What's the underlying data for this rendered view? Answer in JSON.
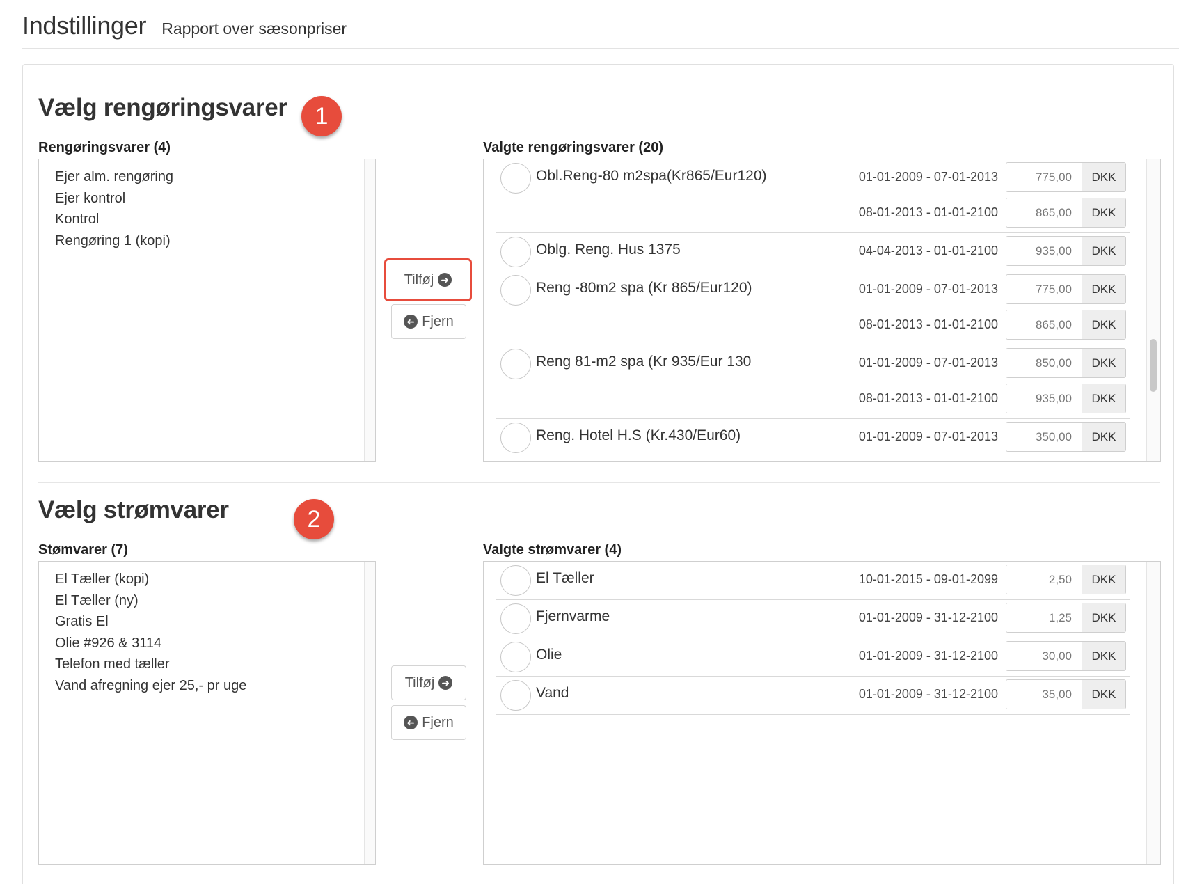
{
  "header": {
    "title": "Indstillinger",
    "subtitle": "Rapport over sæsonpriser"
  },
  "cleaning": {
    "heading": "Vælg rengøringsvarer",
    "badge": "1",
    "available_label": "Rengøringsvarer (4)",
    "available": [
      "Ejer alm. rengøring",
      "Ejer kontrol",
      "Kontrol",
      "Rengøring 1 (kopi)"
    ],
    "add_label": "Tilføj",
    "remove_label": "Fjern",
    "selected_label": "Valgte rengøringsvarer (20)",
    "selected": [
      {
        "name": "Obl.Reng-80 m2spa(Kr865/Eur120)",
        "prices": [
          {
            "period": "01-01-2009 - 07-01-2013",
            "price": "775,00",
            "currency": "DKK"
          },
          {
            "period": "08-01-2013 - 01-01-2100",
            "price": "865,00",
            "currency": "DKK"
          }
        ]
      },
      {
        "name": "Oblg. Reng. Hus 1375",
        "prices": [
          {
            "period": "04-04-2013 - 01-01-2100",
            "price": "935,00",
            "currency": "DKK"
          }
        ]
      },
      {
        "name": "Reng -80m2 spa (Kr 865/Eur120)",
        "prices": [
          {
            "period": "01-01-2009 - 07-01-2013",
            "price": "775,00",
            "currency": "DKK"
          },
          {
            "period": "08-01-2013 - 01-01-2100",
            "price": "865,00",
            "currency": "DKK"
          }
        ]
      },
      {
        "name": "Reng 81-m2 spa (Kr 935/Eur 130",
        "prices": [
          {
            "period": "01-01-2009 - 07-01-2013",
            "price": "850,00",
            "currency": "DKK"
          },
          {
            "period": "08-01-2013 - 01-01-2100",
            "price": "935,00",
            "currency": "DKK"
          }
        ]
      },
      {
        "name": "Reng. Hotel H.S (Kr.430/Eur60)",
        "prices": [
          {
            "period": "01-01-2009 - 07-01-2013",
            "price": "350,00",
            "currency": "DKK"
          }
        ]
      }
    ]
  },
  "power": {
    "heading": "Vælg strømvarer",
    "badge": "2",
    "available_label": "Stømvarer (7)",
    "available": [
      "El Tæller (kopi)",
      "El Tæller (ny)",
      "Gratis El",
      "Olie #926 & 3114",
      "Telefon med tæller",
      "Vand afregning ejer 25,- pr uge"
    ],
    "add_label": "Tilføj",
    "remove_label": "Fjern",
    "selected_label": "Valgte strømvarer (4)",
    "selected": [
      {
        "name": "El Tæller",
        "prices": [
          {
            "period": "10-01-2015 - 09-01-2099",
            "price": "2,50",
            "currency": "DKK"
          }
        ]
      },
      {
        "name": "Fjernvarme",
        "prices": [
          {
            "period": "01-01-2009 - 31-12-2100",
            "price": "1,25",
            "currency": "DKK"
          }
        ]
      },
      {
        "name": "Olie",
        "prices": [
          {
            "period": "01-01-2009 - 31-12-2100",
            "price": "30,00",
            "currency": "DKK"
          }
        ]
      },
      {
        "name": "Vand",
        "prices": [
          {
            "period": "01-01-2009 - 31-12-2100",
            "price": "35,00",
            "currency": "DKK"
          }
        ]
      }
    ]
  },
  "colors": {
    "badge": "#e74c3c",
    "highlight_border": "#e74c3c"
  },
  "icons": {
    "add": "arrow-circle-right-icon",
    "remove": "arrow-circle-left-icon"
  }
}
